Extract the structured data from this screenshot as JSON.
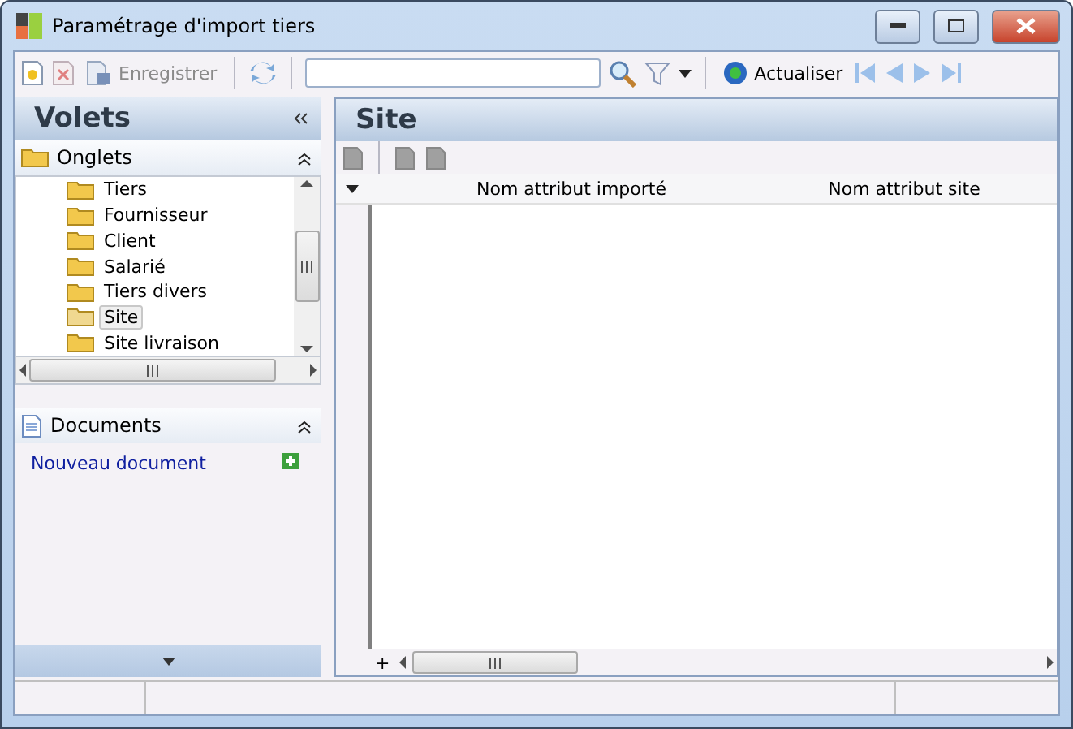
{
  "window": {
    "title": "Paramétrage d'import tiers"
  },
  "toolbar": {
    "save": {
      "label": "Enregistrer",
      "disabled": true
    },
    "refresh": {
      "label": "Actualiser"
    }
  },
  "left_panel": {
    "title": "Volets",
    "tabs_section": {
      "title": "Onglets",
      "items": [
        {
          "label": "Tiers",
          "selected": false
        },
        {
          "label": "Fournisseur",
          "selected": false
        },
        {
          "label": "Client",
          "selected": false
        },
        {
          "label": "Salarié",
          "selected": false
        },
        {
          "label": "Tiers divers",
          "selected": false
        },
        {
          "label": "Site",
          "selected": true
        },
        {
          "label": "Site livraison",
          "selected": false
        }
      ]
    },
    "documents_section": {
      "title": "Documents",
      "link": "Nouveau document"
    }
  },
  "main": {
    "title": "Site",
    "columns": [
      "Nom attribut importé",
      "Nom attribut site"
    ],
    "add_button": "+"
  }
}
